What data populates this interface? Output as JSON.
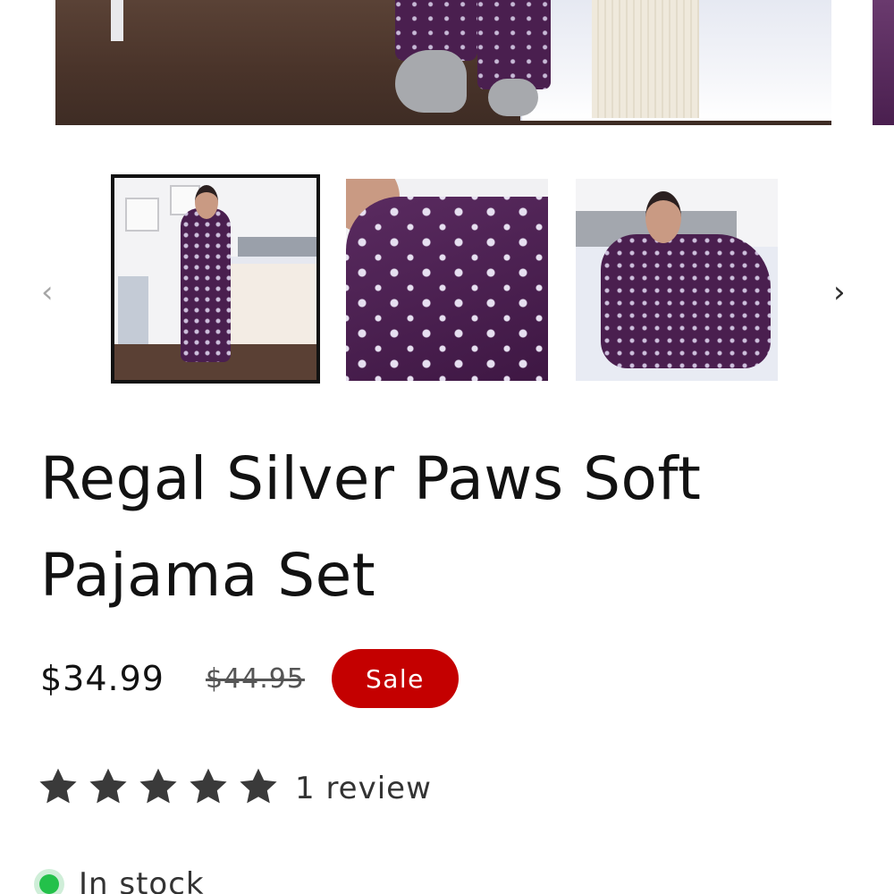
{
  "product": {
    "title": "Regal Silver Paws Soft Pajama Set",
    "price": "$34.99",
    "compare_price": "$44.95",
    "sale_badge": "Sale",
    "rating": {
      "stars": 5,
      "max": 5,
      "review_text": "1 review"
    },
    "stock_text": "In stock"
  },
  "gallery": {
    "prev_label": "‹",
    "next_label": "›",
    "active_index": 0,
    "thumbnails": [
      {
        "name": "full-body"
      },
      {
        "name": "fabric-closeup"
      },
      {
        "name": "sitting-on-bed"
      }
    ]
  },
  "colors": {
    "sale": "#c40000",
    "stock_dot": "#23c14a",
    "fabric": "#4a1f4f",
    "star": "#121212"
  },
  "icons": {
    "prev": "chevron-left-icon",
    "next": "chevron-right-icon",
    "star": "star-icon",
    "stock": "in-stock-dot-icon"
  }
}
